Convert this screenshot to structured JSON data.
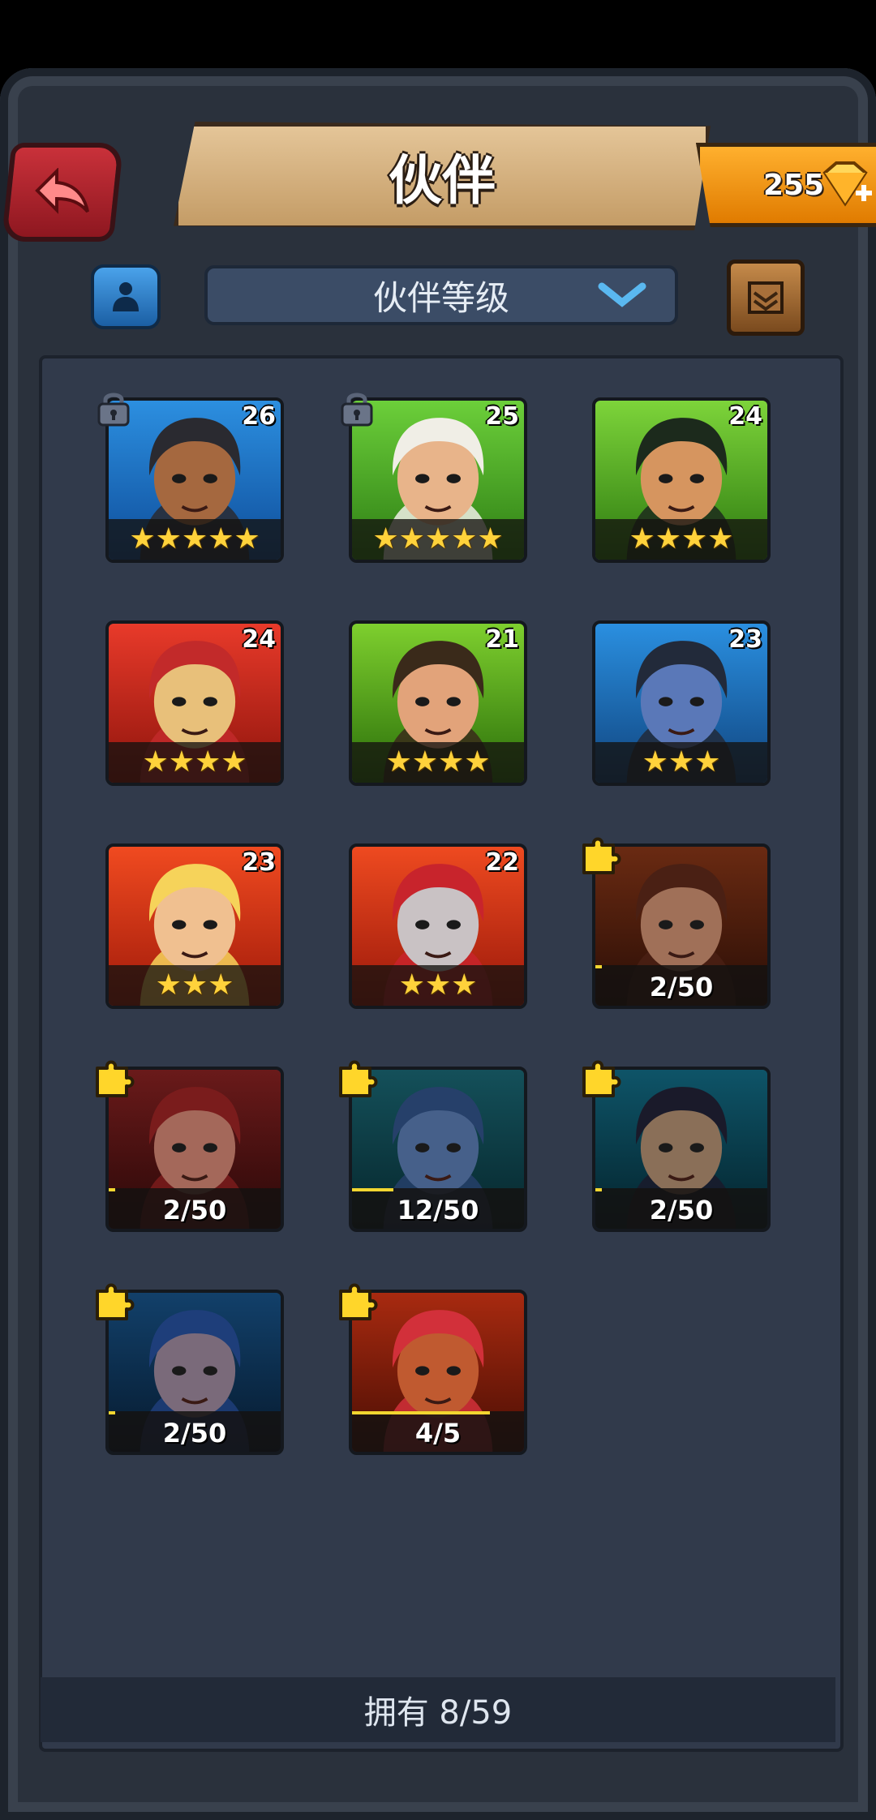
{
  "header": {
    "title": "伙伴",
    "gems": "255"
  },
  "toolbar": {
    "sort_label": "伙伴等级"
  },
  "companions": [
    {
      "level": "26",
      "stars": "★★★★★",
      "locked": true,
      "colors": [
        "#2c8fe0",
        "#0e4d9a"
      ],
      "skin": "#a5683f",
      "hair": "#2a2a30"
    },
    {
      "level": "25",
      "stars": "★★★★★",
      "locked": true,
      "colors": [
        "#6ccf3a",
        "#2d7d14"
      ],
      "skin": "#e8b48a",
      "hair": "#f0eee6"
    },
    {
      "level": "24",
      "stars": "★★★★",
      "locked": false,
      "colors": [
        "#7dd43a",
        "#2d7a10"
      ],
      "skin": "#d6955f",
      "hair": "#1c2a1c"
    },
    {
      "level": "24",
      "stars": "★★★★",
      "locked": false,
      "colors": [
        "#e83a2a",
        "#8e140c"
      ],
      "skin": "#e8c07a",
      "hair": "#c22a2a"
    },
    {
      "level": "21",
      "stars": "★★★★",
      "locked": false,
      "colors": [
        "#7ecf2e",
        "#2a6e0a"
      ],
      "skin": "#e2a37a",
      "hair": "#3a2a1a"
    },
    {
      "level": "23",
      "stars": "★★★",
      "locked": false,
      "colors": [
        "#2a8fe0",
        "#10447e"
      ],
      "skin": "#5a78b8",
      "hair": "#222a3a"
    },
    {
      "level": "23",
      "stars": "★★★",
      "locked": false,
      "colors": [
        "#f04a20",
        "#a01a0a"
      ],
      "skin": "#f0c090",
      "hair": "#f6d35a"
    },
    {
      "level": "22",
      "stars": "★★★",
      "locked": false,
      "colors": [
        "#ee4a20",
        "#9a180a"
      ],
      "skin": "#c9c2c4",
      "hair": "#c8242c"
    }
  ],
  "shards": [
    {
      "progress": "2/50",
      "fraction": 0.04,
      "colors": [
        "#6a2a12",
        "#2a0e06"
      ],
      "skin": "#a07058",
      "hair": "#4a2014"
    },
    {
      "progress": "2/50",
      "fraction": 0.04,
      "colors": [
        "#6a1a1a",
        "#2a0808"
      ],
      "skin": "#a4685a",
      "hair": "#7a1c1c"
    },
    {
      "progress": "12/50",
      "fraction": 0.24,
      "colors": [
        "#14505a",
        "#06262c"
      ],
      "skin": "#46608a",
      "hair": "#26406a"
    },
    {
      "progress": "2/50",
      "fraction": 0.04,
      "colors": [
        "#0e5468",
        "#04232c"
      ],
      "skin": "#8a6f58",
      "hair": "#1a1a2a"
    },
    {
      "progress": "2/50",
      "fraction": 0.04,
      "colors": [
        "#12406a",
        "#061a2e"
      ],
      "skin": "#7a6a7a",
      "hair": "#1e3e7a"
    },
    {
      "progress": "4/5",
      "fraction": 0.8,
      "colors": [
        "#a82a10",
        "#4a0e04"
      ],
      "skin": "#c05a30",
      "hair": "#d2303a"
    }
  ],
  "footer": {
    "owned": "拥有 8/59"
  },
  "icons": [
    "back-arrow-icon",
    "gem-icon",
    "plus-icon",
    "filter-icon",
    "chevron-down-icon",
    "scroll-icon",
    "lock-icon",
    "puzzle-icon"
  ]
}
